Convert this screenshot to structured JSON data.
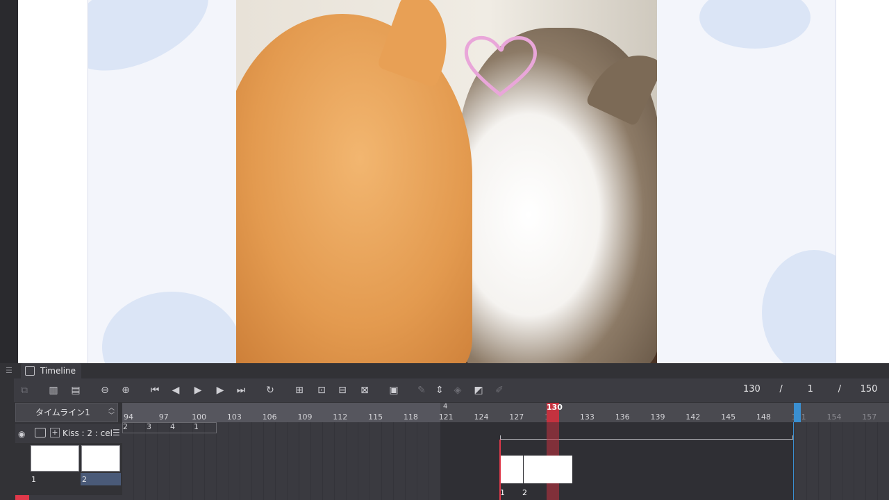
{
  "timeline": {
    "tab_label": "Timeline",
    "menu_icon": "hamburger-icon",
    "timeline_name": "タイムライン1",
    "frame_current": "130",
    "frame_sep1": "/",
    "frame_start": "1",
    "frame_sep2": "/",
    "frame_end": "150",
    "ruler_ticks": [
      "94",
      "97",
      "100",
      "103",
      "106",
      "109",
      "112",
      "115",
      "118",
      "121",
      "124",
      "127",
      "130",
      "133",
      "136",
      "139",
      "142",
      "145",
      "148",
      "151",
      "154",
      "157"
    ],
    "ruler_marker": "4",
    "playhead_label": "130",
    "layer": {
      "name": "Kiss : 2 : cel",
      "thumb_labels": [
        "1",
        "2"
      ]
    },
    "key_numbers": [
      "2",
      "3",
      "4",
      "1"
    ],
    "cel_labels": [
      "1",
      "2"
    ]
  },
  "colors": {
    "playhead": "#c4323f",
    "end_marker": "#3a8fd1",
    "heart": "#e9a6d9"
  }
}
